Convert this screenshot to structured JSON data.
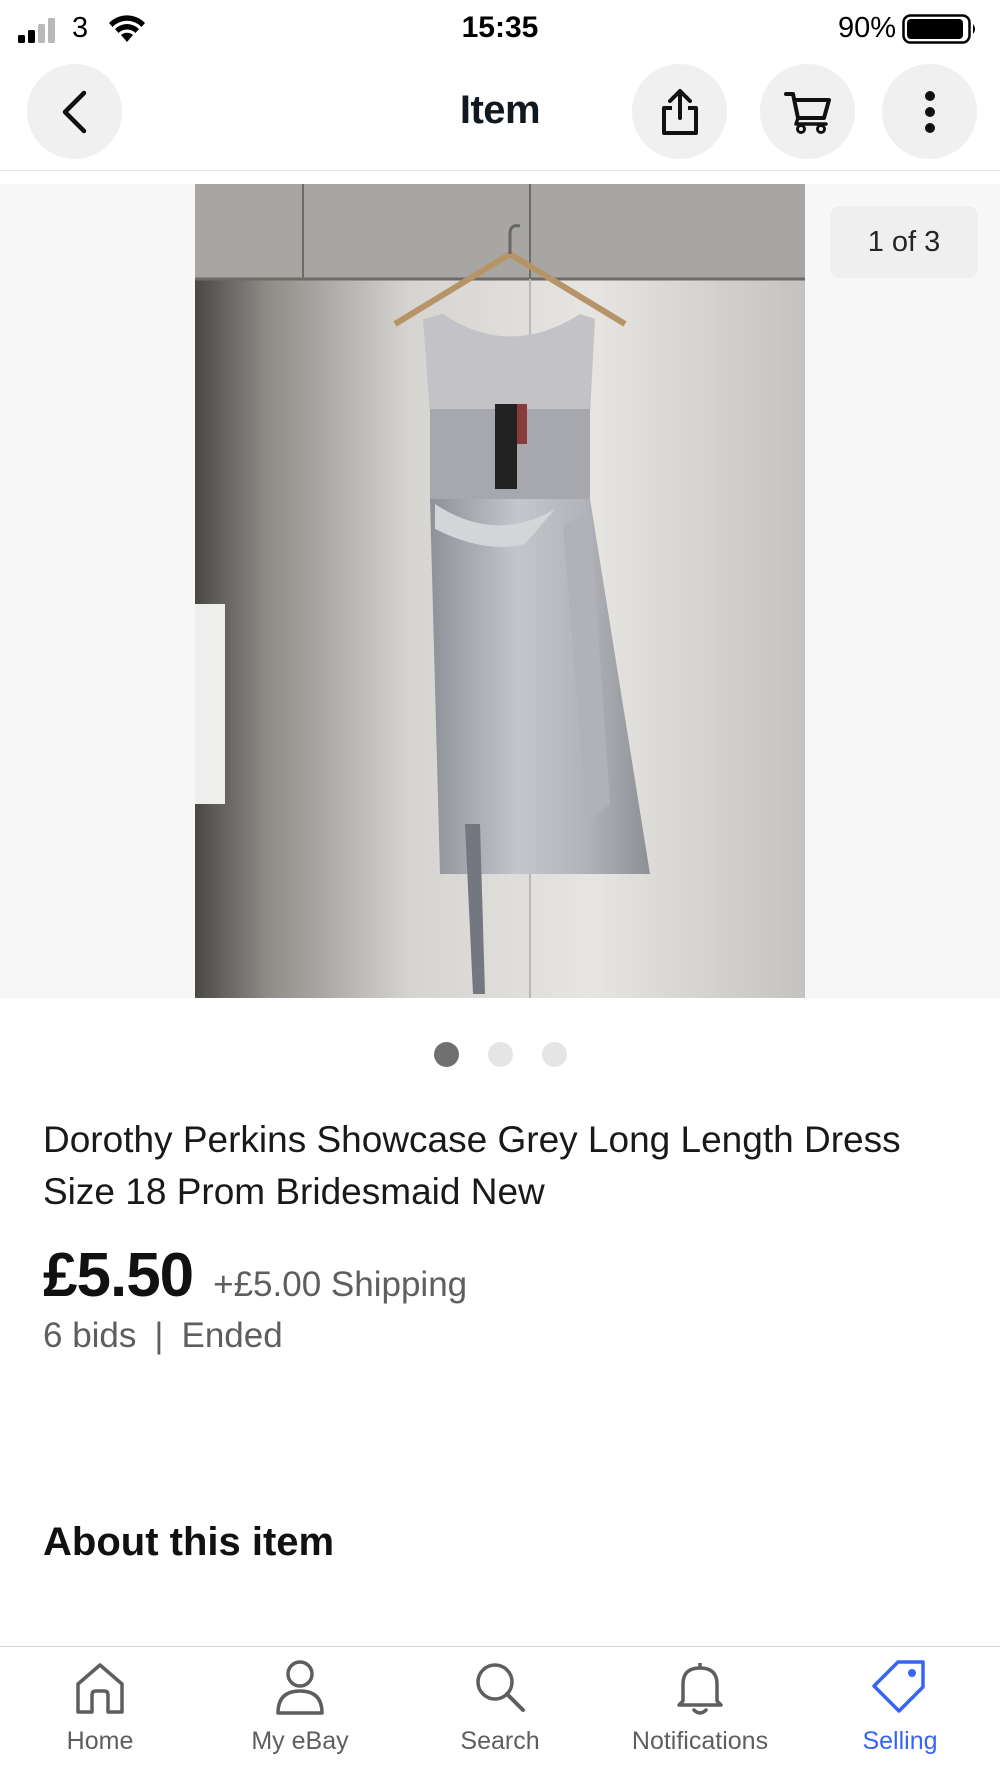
{
  "status_bar": {
    "carrier": "3",
    "time": "15:35",
    "battery": "90%"
  },
  "nav": {
    "title": "Item"
  },
  "gallery": {
    "counter": "1 of 3",
    "dots": 3,
    "active_dot": 0
  },
  "item": {
    "title": "Dorothy Perkins Showcase Grey Long Length Dress Size 18 Prom Bridesmaid New",
    "price": "£5.50",
    "shipping": "+£5.00 Shipping",
    "bids": "6 bids",
    "separator": "|",
    "status": "Ended"
  },
  "section": {
    "about_heading": "About this item"
  },
  "tabs": [
    {
      "label": "Home",
      "icon": "home-icon"
    },
    {
      "label": "My eBay",
      "icon": "person-icon"
    },
    {
      "label": "Search",
      "icon": "search-icon"
    },
    {
      "label": "Notifications",
      "icon": "bell-icon"
    },
    {
      "label": "Selling",
      "icon": "tag-icon"
    }
  ],
  "colors": {
    "accent": "#3665f3",
    "text": "#111820",
    "secondary_text": "#5e5e5e"
  }
}
